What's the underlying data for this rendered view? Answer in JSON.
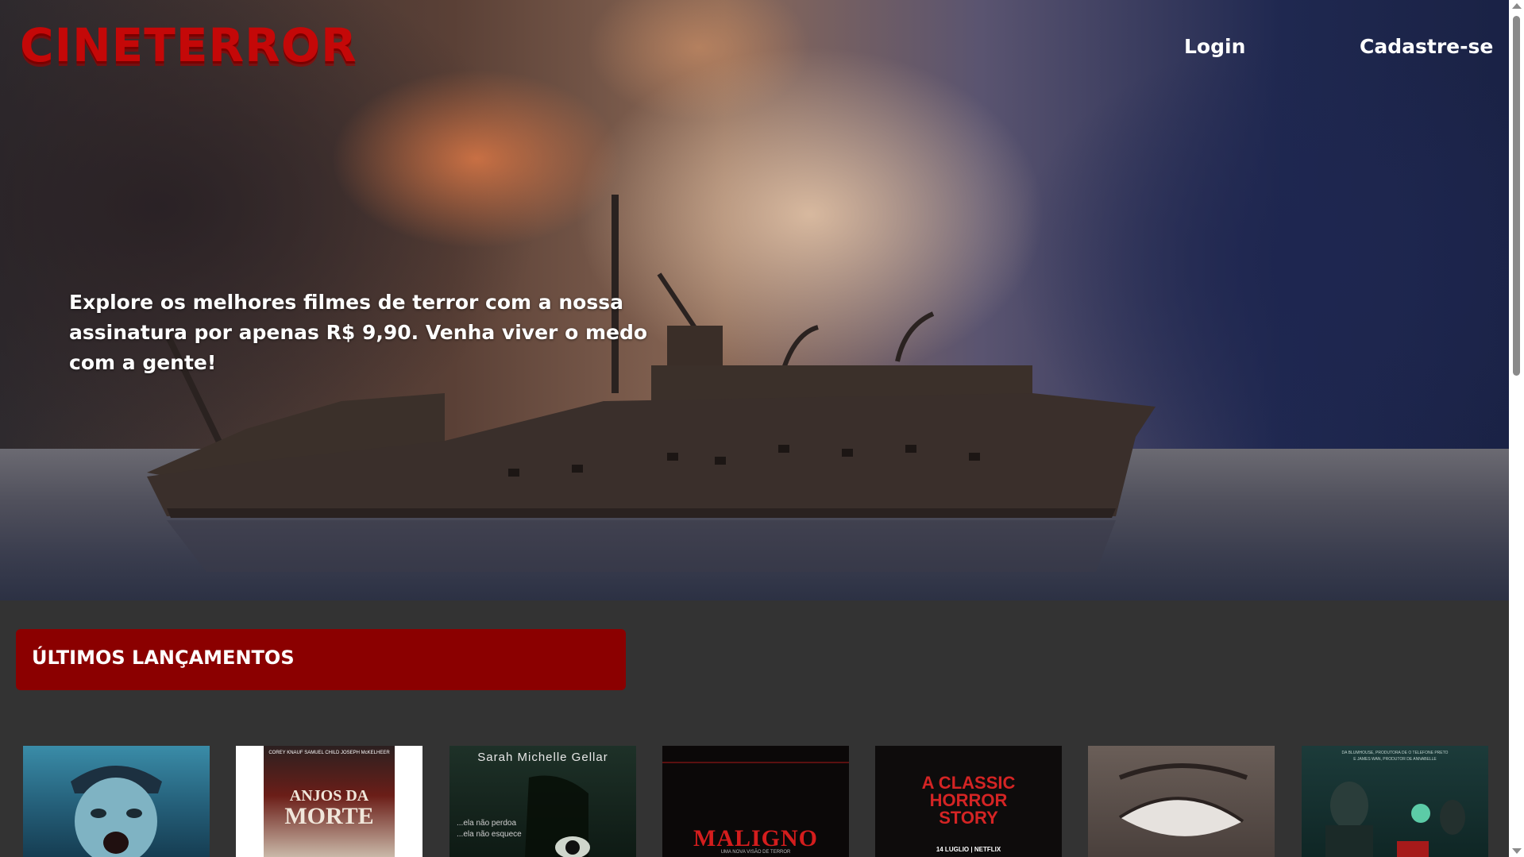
{
  "header": {
    "logo_text": "CINETERROR",
    "nav": {
      "login_label": "Login",
      "signup_label": "Cadastre-se"
    }
  },
  "hero": {
    "tagline": "Explore os melhores filmes de terror com a nossa assinatura por apenas R$ 9,90. Venha viver o medo com a gente!"
  },
  "latest": {
    "title": "ÚLTIMOS LANÇAMENTOS",
    "posters": [
      {
        "name": "poster-zombie-officer",
        "texts": []
      },
      {
        "name": "poster-anjos-da-morte",
        "texts": [
          "COREY KNAUF   SAMUEL CHILD   JOSEPH McKELHEER",
          "ANJOS DA",
          "MORTE"
        ]
      },
      {
        "name": "poster-the-grudge",
        "texts": [
          "Sarah Michelle Gellar",
          "...ela não perdoa",
          "...ela não esquece"
        ]
      },
      {
        "name": "poster-maligno",
        "texts": [
          "MALIGNO",
          "UMA NOVA VISÃO DE TERROR"
        ]
      },
      {
        "name": "poster-a-classic-horror-story",
        "texts": [
          "A CLASSIC",
          "HORROR",
          "STORY",
          "14 LUGLIO | NETFLIX"
        ]
      },
      {
        "name": "poster-white-eye",
        "texts": []
      },
      {
        "name": "poster-telefone-preto",
        "texts": [
          "DA BLUMHOUSE, PRODUTORA DE O TELEFONE PRETO",
          "E JAMES WAN, PRODUTOR DE ANNABELLE"
        ]
      }
    ]
  },
  "colors": {
    "logo": "#c40808",
    "banner": "#8b0000",
    "page_background": "#333333",
    "text": "#ffffff"
  }
}
